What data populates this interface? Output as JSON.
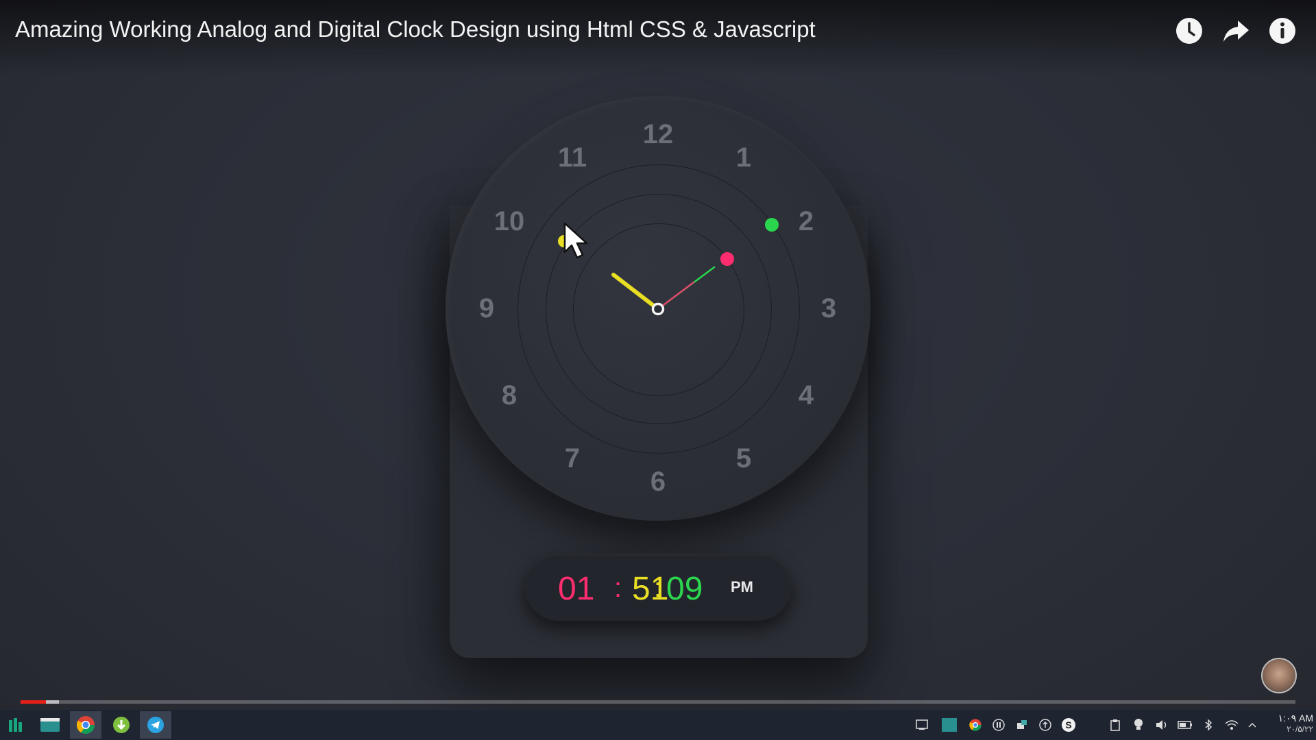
{
  "video": {
    "title": "Amazing Working Analog and Digital Clock Design using Html CSS & Javascript",
    "progress_played": 0.02,
    "progress_buffered": 0.03
  },
  "top_icons": [
    "watch-later-icon",
    "share-icon",
    "info-icon"
  ],
  "clock": {
    "numbers": [
      "12",
      "1",
      "2",
      "3",
      "4",
      "5",
      "6",
      "7",
      "8",
      "9",
      "10",
      "11"
    ],
    "digital": {
      "hours": "01",
      "minutes": "51",
      "seconds": "09",
      "separator": ":",
      "ampm": "PM"
    },
    "colors": {
      "hour": "#ff2d6f",
      "minute": "#e8df24",
      "second": "#2bd64e",
      "background": "#2c2e36"
    }
  },
  "taskbar": {
    "apps": [
      "app-manager-icon",
      "file-explorer-icon",
      "chrome-icon",
      "download-manager-icon",
      "telegram-icon"
    ],
    "tray": [
      "show-desktop-icon",
      "screen-icon",
      "chrome-tray-icon",
      "pause-icon",
      "connect-icon",
      "upload-icon",
      "skype-icon",
      "clipboard-icon",
      "bulb-icon",
      "volume-icon",
      "battery-icon",
      "bluetooth-icon",
      "wifi-icon",
      "chevron-up-icon"
    ],
    "time": "۱:۰۹ AM",
    "date": "۲۰/۵/۲۲"
  }
}
